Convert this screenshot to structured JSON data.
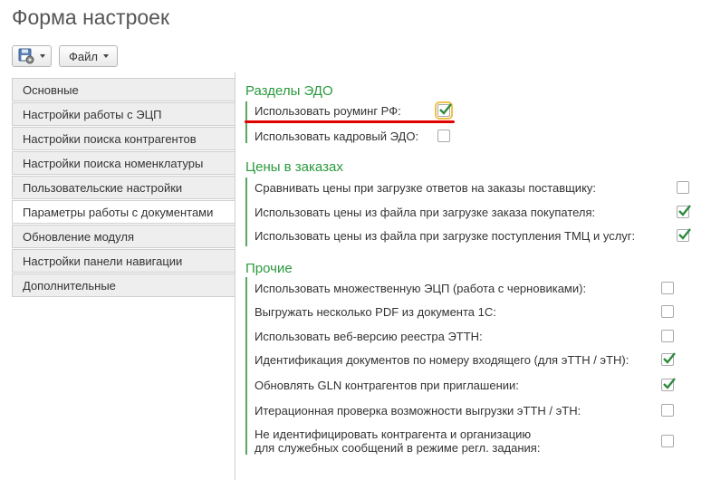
{
  "window": {
    "title": "Форма настроек"
  },
  "toolbar": {
    "file_label": "Файл",
    "save_icon": "save-settings-icon"
  },
  "tabs": [
    {
      "label": "Основные"
    },
    {
      "label": "Настройки работы с ЭЦП"
    },
    {
      "label": "Настройки поиска контрагентов"
    },
    {
      "label": "Настройки поиска номенклатуры"
    },
    {
      "label": "Пользовательские настройки"
    },
    {
      "label": "Параметры работы с документами"
    },
    {
      "label": "Обновление модуля"
    },
    {
      "label": "Настройки панели навигации"
    },
    {
      "label": "Дополнительные"
    }
  ],
  "active_tab": "Параметры работы с документами",
  "sections": {
    "edo": {
      "title": "Разделы ЭДО",
      "items": [
        {
          "label": "Использовать роуминг РФ:",
          "checked": true
        },
        {
          "label": "Использовать кадровый ЭДО:",
          "checked": false
        }
      ]
    },
    "prices": {
      "title": "Цены в заказах",
      "items": [
        {
          "label": "Сравнивать цены при загрузке ответов на заказы поставщику:",
          "checked": false
        },
        {
          "label": "Использовать цены из файла при загрузке заказа покупателя:",
          "checked": true
        },
        {
          "label": "Использовать цены из файла при загрузке поступления ТМЦ и услуг:",
          "checked": true
        }
      ]
    },
    "other": {
      "title": "Прочие",
      "items": [
        {
          "label": "Использовать множественную ЭЦП (работа с черновиками):",
          "checked": false
        },
        {
          "label": "Выгружать несколько PDF из документа 1С:",
          "checked": false
        },
        {
          "label": "Использовать веб-версию реестра ЭТТН:",
          "checked": false
        },
        {
          "label": "Идентификация документов по номеру входящего (для эТТН / эТН):",
          "checked": true
        },
        {
          "label": "Обновлять GLN контрагентов при приглашении:",
          "checked": true
        },
        {
          "label": "Итерационная проверка возможности выгрузки эТТН / эТН:",
          "checked": false
        },
        {
          "label_line1": "Не идентифицировать контрагента и организацию",
          "label_line2": "для служебных сообщений в режиме регл. задания:",
          "checked": false
        }
      ]
    }
  },
  "colors": {
    "section_heading": "#2b9a3e",
    "check": "#2e8b3e",
    "annotation": "#e00000",
    "focus": "#f0c24b"
  }
}
